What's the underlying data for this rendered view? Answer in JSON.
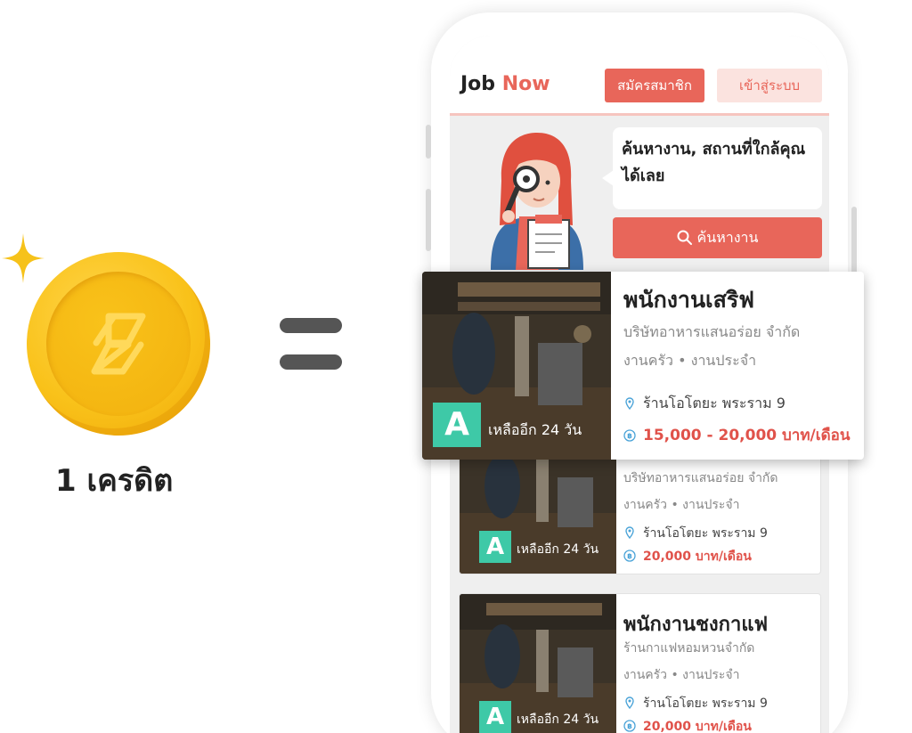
{
  "promo": {
    "credit_label": "1 เครดิต"
  },
  "app": {
    "brand_part1": "Job",
    "brand_part2": "Now",
    "register_label": "สมัครสมาชิก",
    "login_label": "เข้าสู่ระบบ",
    "hero_text_line1": "ค้นหางาน, สถานที่ใกล้คุณ",
    "hero_text_line2": "ได้เลย",
    "search_label": "ค้นหางาน"
  },
  "featured_job": {
    "title": "พนักงานเสริฟ",
    "company": "บริษัทอาหารแสนอร่อย จำกัด",
    "type": "งานครัว • งานประจำ",
    "location": "ร้านโอโตยะ พระราม 9",
    "salary": "15,000 - 20,000 บาท/เดือน",
    "grade": "A",
    "days_left": "เหลืออีก 24 วัน"
  },
  "jobs": [
    {
      "title": "",
      "company": "บริษัทอาหารแสนอร่อย จำกัด",
      "type": "งานครัว • งานประจำ",
      "location": "ร้านโอโตยะ พระราม 9",
      "salary": "20,000 บาท/เดือน",
      "grade": "A",
      "days_left": "เหลืออีก 24 วัน"
    },
    {
      "title": "พนักงานชงกาแฟ",
      "company": "ร้านกาแฟหอมหวนจำกัด",
      "type": "งานครัว • งานประจำ",
      "location": "ร้านโอโตยะ พระราม 9",
      "salary": "20,000 บาท/เดือน",
      "grade": "A",
      "days_left": "เหลืออีก 24 วัน"
    }
  ],
  "colors": {
    "accent": "#e8665a",
    "accent_light": "#fbe3df",
    "grade_badge": "#3ec9a7",
    "salary_text": "#e0524a",
    "coin": "#f9c21a"
  },
  "icons": [
    "sparkle-icon",
    "coin-logo-icon",
    "search-icon",
    "location-pin-icon",
    "money-icon"
  ]
}
